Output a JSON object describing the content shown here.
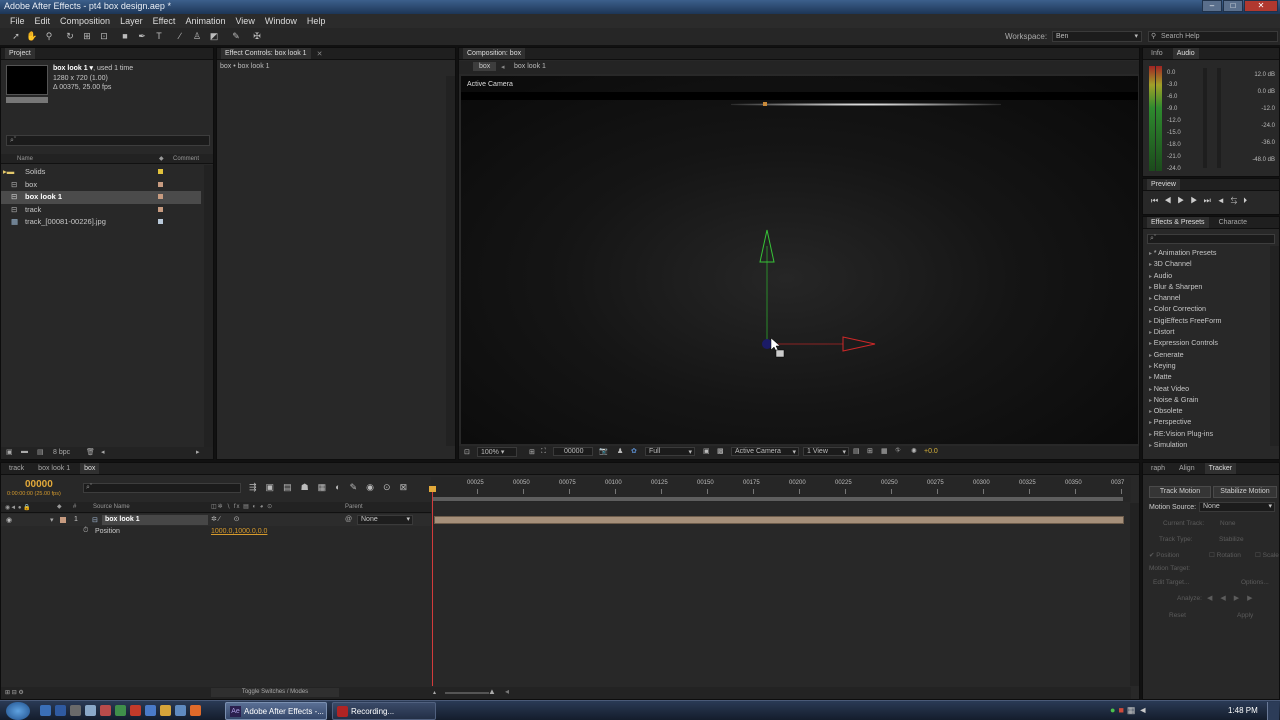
{
  "window": {
    "title": "Adobe After Effects - pt4 box design.aep *"
  },
  "menu": [
    "File",
    "Edit",
    "Composition",
    "Layer",
    "Effect",
    "Animation",
    "View",
    "Window",
    "Help"
  ],
  "toolbar": {
    "workspace_label": "Workspace:",
    "workspace_value": "Ben",
    "search_placeholder": "Search Help"
  },
  "project": {
    "tab": "Project",
    "selected_name": "box look 1 ▾",
    "used": ", used 1 time",
    "dims": "1280 x 720 (1.00)",
    "duration": "Δ 00375, 25.00 fps",
    "search_placeholder": "⌕ˇ",
    "col_name": "Name",
    "col_comment": "Comment",
    "items": [
      {
        "name": "Solids",
        "color": "#e1c23c"
      },
      {
        "name": "box",
        "color": "#c79b80"
      },
      {
        "name": "box look 1",
        "color": "#c79b80"
      },
      {
        "name": "track",
        "color": "#c79b80"
      },
      {
        "name": "track_[00081-00226].jpg",
        "color": "#b9c9d9"
      }
    ],
    "bpc": "8 bpc"
  },
  "effect_controls": {
    "tab": "Effect Controls: box look 1",
    "breadcrumb": "box • box look 1"
  },
  "composition": {
    "tab": "Composition: box",
    "nav": [
      "box",
      "box look 1"
    ],
    "camera_label": "Active Camera",
    "zoom": "100%",
    "timecode": "00000",
    "resolution": "Full",
    "camera": "Active Camera",
    "view": "1 View",
    "exposure": "+0.0"
  },
  "info_audio": {
    "tabs": [
      "Info",
      "Audio"
    ],
    "left_scale": [
      "0.0",
      "-3.0",
      "-6.0",
      "-9.0",
      "-12.0",
      "-15.0",
      "-18.0",
      "-21.0",
      "-24.0"
    ],
    "right_scale": [
      "12.0 dB",
      "0.0 dB",
      "-12.0",
      "-24.0",
      "-36.0",
      "-48.0 dB"
    ]
  },
  "preview": {
    "tab": "Preview"
  },
  "effects_presets": {
    "tabs": [
      "Effects & Presets",
      "Characte"
    ],
    "search_placeholder": "⌕ˇ",
    "items": [
      "* Animation Presets",
      "3D Channel",
      "Audio",
      "Blur & Sharpen",
      "Channel",
      "Color Correction",
      "DigiEffects FreeForm",
      "Distort",
      "Expression Controls",
      "Generate",
      "Keying",
      "Matte",
      "Neat Video",
      "Noise & Grain",
      "Obsolete",
      "Perspective",
      "RE:Vision Plug-ins",
      "Simulation"
    ]
  },
  "timeline": {
    "tabs": [
      "track",
      "box look 1",
      "box"
    ],
    "timecode": "00000",
    "timecode_sub": "0:00:00:00 (25.00 fps)",
    "search_placeholder": "⌕ˇ",
    "col_source": "Source Name",
    "col_parent": "Parent",
    "layer_num": "1",
    "layer_name": "box look 1",
    "parent_value": "None",
    "prop_name": "Position",
    "prop_value": "1000.0,1000.0,0.0",
    "toggle_label": "Toggle Switches / Modes",
    "ruler": [
      "00025",
      "00050",
      "00075",
      "00100",
      "00125",
      "00150",
      "00175",
      "00200",
      "00225",
      "00250",
      "00275",
      "00300",
      "00325",
      "00350",
      "0037"
    ]
  },
  "tracker": {
    "tabs": [
      "raph",
      "Align",
      "Tracker"
    ],
    "track_motion": "Track Motion",
    "stabilize_motion": "Stabilize Motion",
    "motion_source_label": "Motion Source:",
    "motion_source_value": "None",
    "current_track_label": "Current Track:",
    "current_track_value": "None",
    "track_type_label": "Track Type:",
    "track_type_value": "Stabilize",
    "checks": [
      "Position",
      "Rotation",
      "Scale"
    ],
    "motion_target": "Motion Target:",
    "edit_target": "Edit Target...",
    "options": "Options...",
    "analyze": "Analyze:",
    "reset": "Reset",
    "apply": "Apply"
  },
  "taskbar": {
    "task1": "Adobe After Effects -...",
    "task2": "Recording...",
    "clock": "1:48 PM"
  }
}
